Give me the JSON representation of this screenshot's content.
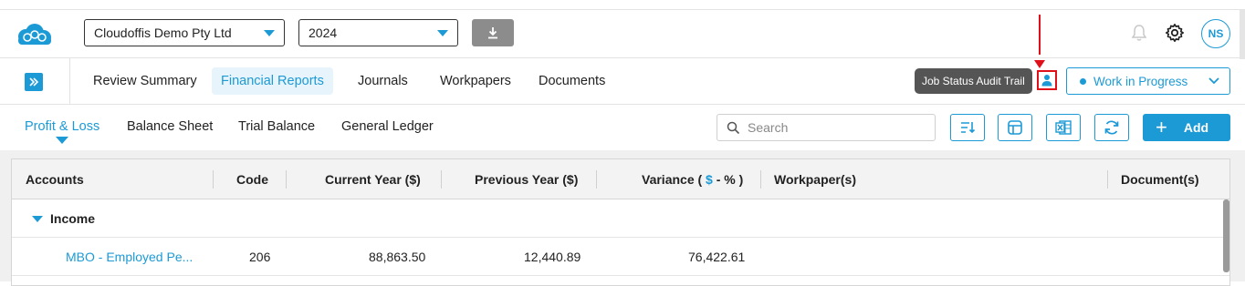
{
  "header": {
    "company_select": "Cloudoffis Demo Pty Ltd",
    "year_select": "2024",
    "avatar_initials": "NS"
  },
  "nav": {
    "tabs": [
      {
        "label": "Review Summary"
      },
      {
        "label": "Financial Reports"
      },
      {
        "label": "Journals"
      },
      {
        "label": "Workpapers"
      },
      {
        "label": "Documents"
      }
    ],
    "tooltip": "Job Status Audit Trail",
    "status_select": "Work in Progress"
  },
  "subnav": {
    "tabs": [
      {
        "label": "Profit & Loss"
      },
      {
        "label": "Balance Sheet"
      },
      {
        "label": "Trial Balance"
      },
      {
        "label": "General Ledger"
      }
    ],
    "search_placeholder": "Search",
    "add_label": "Add"
  },
  "table": {
    "headers": {
      "accounts": "Accounts",
      "code": "Code",
      "current_year": "Current Year ($)",
      "previous_year": "Previous Year ($)",
      "variance_prefix": "Variance (",
      "variance_dollar": "$",
      "variance_suffix": "- % )",
      "workpapers": "Workpaper(s)",
      "documents": "Document(s)"
    },
    "group": "Income",
    "rows": [
      {
        "account": "MBO - Employed Pe...",
        "code": "206",
        "current_year": "88,863.50",
        "previous_year": "12,440.89",
        "variance": "76,422.61"
      }
    ]
  },
  "colors": {
    "accent": "#1c9ad6",
    "highlight": "#e0101a"
  }
}
